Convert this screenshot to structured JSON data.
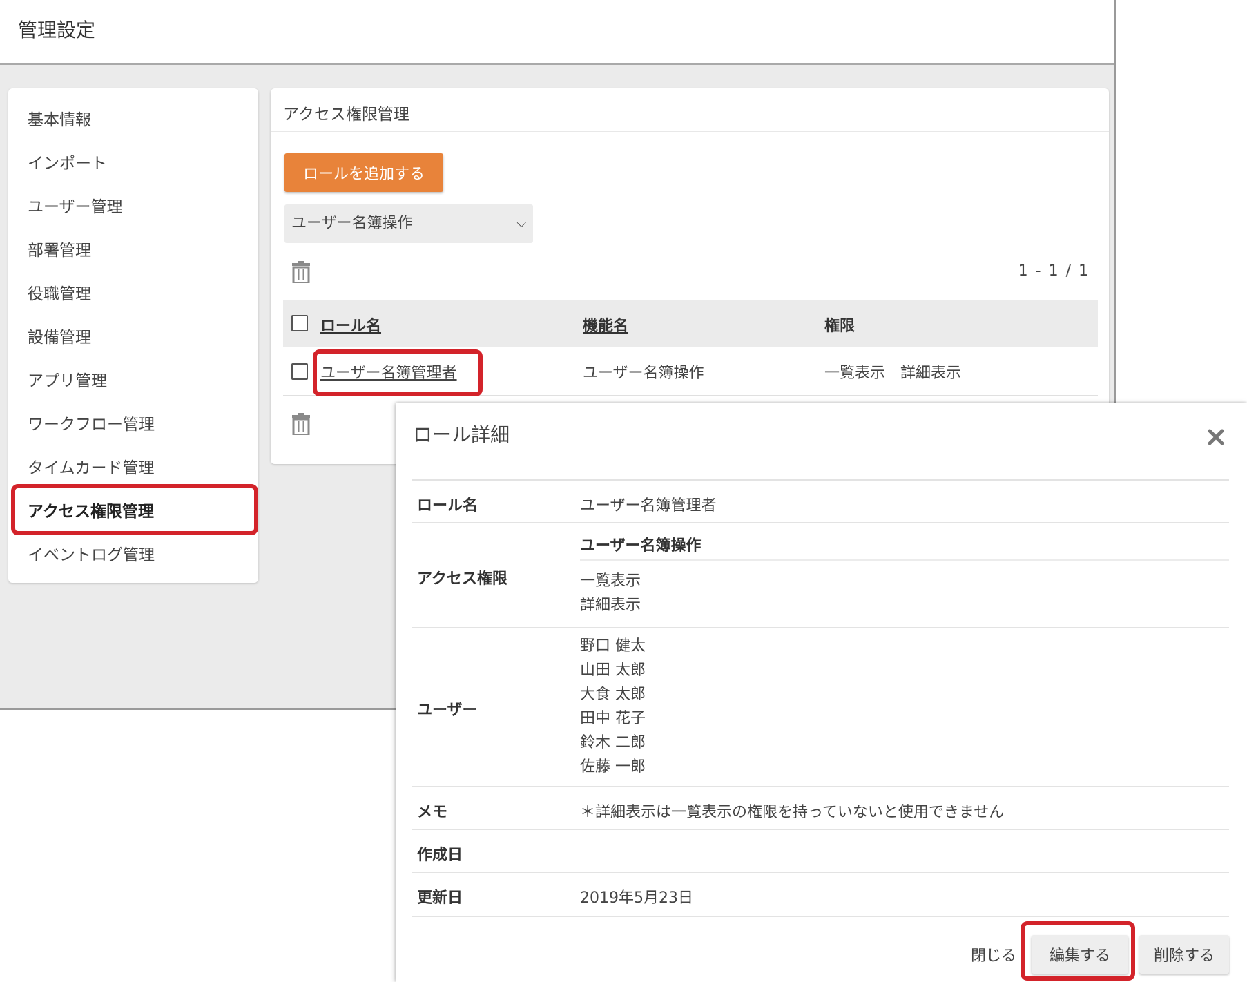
{
  "app": {
    "title": "管理設定"
  },
  "sidebar": {
    "items": [
      {
        "label": "基本情報"
      },
      {
        "label": "インポート"
      },
      {
        "label": "ユーザー管理"
      },
      {
        "label": "部署管理"
      },
      {
        "label": "役職管理"
      },
      {
        "label": "設備管理"
      },
      {
        "label": "アプリ管理"
      },
      {
        "label": "ワークフロー管理"
      },
      {
        "label": "タイムカード管理"
      },
      {
        "label": "アクセス権限管理"
      },
      {
        "label": "イベントログ管理"
      }
    ],
    "active": "アクセス権限管理"
  },
  "main": {
    "title": "アクセス権限管理",
    "add_role_label": "ロールを追加する",
    "select_value": "ユーザー名簿操作",
    "pagination": "1 - 1 / 1",
    "table": {
      "headers": {
        "role": "ロール名",
        "function": "機能名",
        "permission": "権限"
      },
      "rows": [
        {
          "role": "ユーザー名簿管理者",
          "function": "ユーザー名簿操作",
          "permission": "一覧表示　詳細表示"
        }
      ]
    }
  },
  "modal": {
    "title": "ロール詳細",
    "labels": {
      "role_name": "ロール名",
      "access": "アクセス権限",
      "users": "ユーザー",
      "memo": "メモ",
      "created": "作成日",
      "updated": "更新日"
    },
    "role_name": "ユーザー名簿管理者",
    "access_function": "ユーザー名簿操作",
    "permissions": [
      "一覧表示",
      "詳細表示"
    ],
    "users": [
      "野口 健太",
      "山田 太郎",
      "大食 太郎",
      "田中 花子",
      "鈴木 二郎",
      "佐藤 一郎"
    ],
    "memo": "＊詳細表示は一覧表示の権限を持っていないと使用できません",
    "created": "",
    "updated": "2019年5月23日",
    "buttons": {
      "close": "閉じる",
      "edit": "編集する",
      "delete": "削除する"
    }
  },
  "icons": {
    "trash": "trash-icon",
    "close": "close-icon",
    "chevron": "chevron-down-icon"
  },
  "colors": {
    "accent": "#e8833a",
    "highlight": "#d3232a"
  }
}
